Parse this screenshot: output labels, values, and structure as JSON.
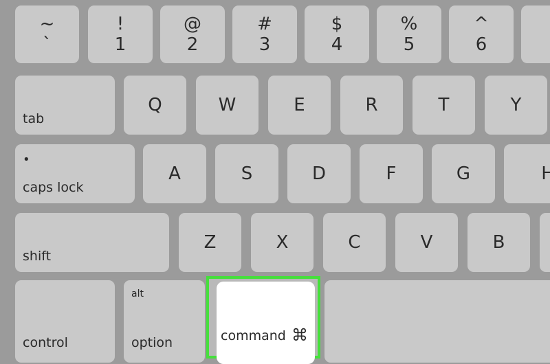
{
  "row1": [
    {
      "top": "~",
      "bottom": "`"
    },
    {
      "top": "!",
      "bottom": "1"
    },
    {
      "top": "@",
      "bottom": "2"
    },
    {
      "top": "#",
      "bottom": "3"
    },
    {
      "top": "$",
      "bottom": "4"
    },
    {
      "top": "%",
      "bottom": "5"
    },
    {
      "top": "^",
      "bottom": "6"
    }
  ],
  "row2": {
    "tab": "tab",
    "letters": [
      "Q",
      "W",
      "E",
      "R",
      "T",
      "Y"
    ]
  },
  "row3": {
    "caps": "caps lock",
    "caps_dot": "•",
    "letters": [
      "A",
      "S",
      "D",
      "F",
      "G",
      "H"
    ]
  },
  "row4": {
    "shift": "shift",
    "letters": [
      "Z",
      "X",
      "C",
      "V",
      "B"
    ]
  },
  "row5": {
    "control": "control",
    "option_top": "alt",
    "option": "option",
    "command": "command",
    "command_symbol": "⌘"
  },
  "highlight_color": "#46df3c"
}
